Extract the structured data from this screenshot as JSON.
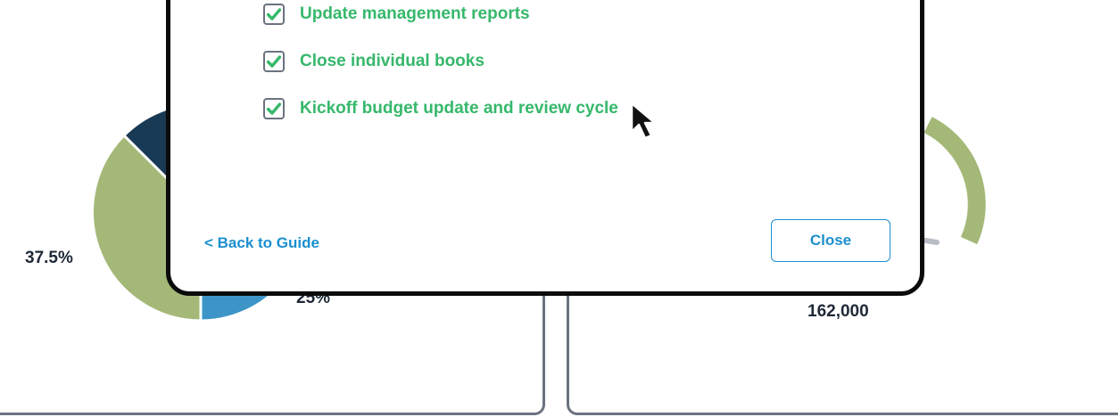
{
  "background": {
    "pie_chart": {
      "slices": [
        {
          "label": "37.5%",
          "value": 37.5,
          "color": "#a4b878"
        },
        {
          "label": "25%",
          "value": 25,
          "color": "#3d95c7"
        },
        {
          "label": "",
          "value": 12.5,
          "color": "#193a55"
        }
      ],
      "label_375": "37.5%",
      "label_25": "25%"
    },
    "gauge": {
      "value_label": "162,000",
      "color": "#a4b878"
    }
  },
  "modal": {
    "tasks": [
      {
        "label": "Update management reports",
        "checked": true
      },
      {
        "label": "Close individual books",
        "checked": true
      },
      {
        "label": "Kickoff budget update and review cycle",
        "checked": true
      }
    ],
    "back_link": "< Back to Guide",
    "close_button": "Close"
  },
  "colors": {
    "check_green": "#36b86b",
    "link_blue": "#1a8fd0",
    "modal_border": "#0b0b0b"
  },
  "icons": {
    "check": "checkmark-icon",
    "cursor": "mouse-pointer-icon"
  }
}
